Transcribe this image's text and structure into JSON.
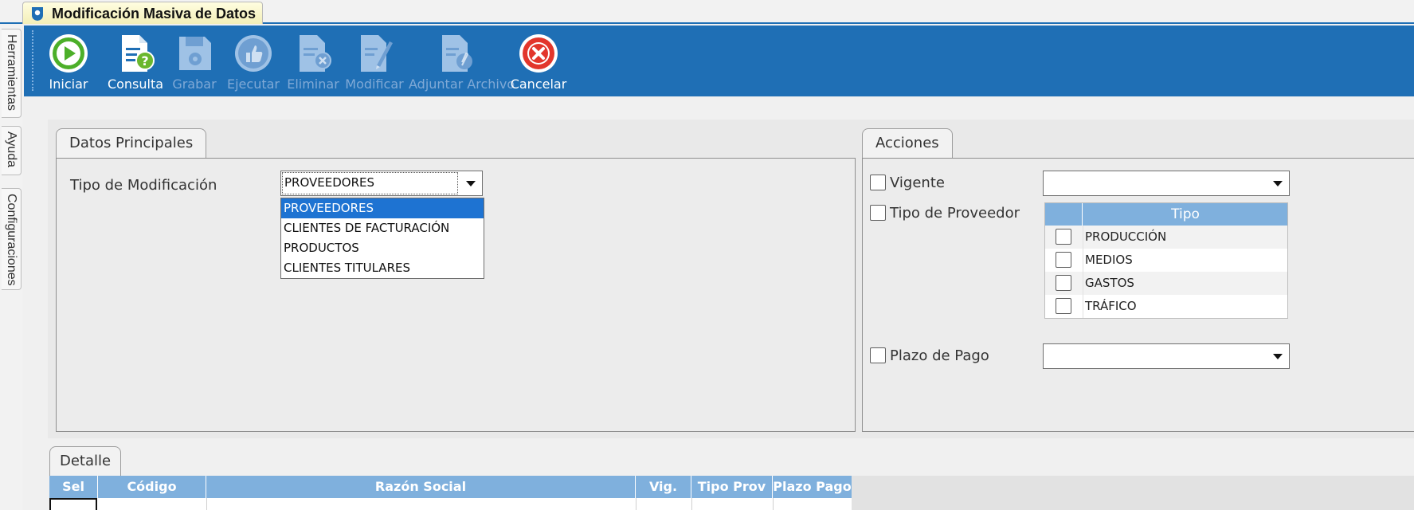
{
  "window": {
    "doc_tab_title": "Modificación Masiva de Datos",
    "side_tabs": [
      "Herramientas",
      "Ayuda",
      "Configuraciones"
    ]
  },
  "toolbar": {
    "buttons": [
      {
        "label": "Iniciar",
        "icon": "play-icon",
        "enabled": true
      },
      {
        "label": "Consulta",
        "icon": "query-document-icon",
        "enabled": true
      },
      {
        "label": "Grabar",
        "icon": "save-disk-icon",
        "enabled": false
      },
      {
        "label": "Ejecutar",
        "icon": "thumbs-up-icon",
        "enabled": false
      },
      {
        "label": "Eliminar",
        "icon": "delete-document-icon",
        "enabled": false
      },
      {
        "label": "Modificar",
        "icon": "edit-document-icon",
        "enabled": false
      },
      {
        "label": "Adjuntar Archivo",
        "icon": "attach-document-icon",
        "enabled": false
      },
      {
        "label": "Cancelar",
        "icon": "cancel-icon",
        "enabled": true
      }
    ]
  },
  "datos_principales": {
    "tab_label": "Datos Principales",
    "tipo_label": "Tipo de Modificación",
    "tipo_value": "PROVEEDORES",
    "options": [
      "PROVEEDORES",
      "CLIENTES DE FACTURACIÓN",
      "PRODUCTOS",
      "CLIENTES TITULARES"
    ],
    "selected_index": 0
  },
  "acciones": {
    "tab_label": "Acciones",
    "vigente_label": "Vigente",
    "vigente_value": "",
    "tipo_proveedor_label": "Tipo de Proveedor",
    "tipo_header": "Tipo",
    "tipos": [
      "PRODUCCIÓN",
      "MEDIOS",
      "GASTOS",
      "TRÁFICO"
    ],
    "plazo_label": "Plazo de Pago",
    "plazo_value": ""
  },
  "detalle": {
    "tab_label": "Detalle",
    "columns": [
      "Sel",
      "Código",
      "Razón Social",
      "Vig.",
      "Tipo Prov",
      "Plazo Pago"
    ]
  },
  "colors": {
    "toolbar_bg": "#1f6fb5",
    "grid_header_bg": "#7fb0dd",
    "dropdown_selected_bg": "#1e73d2"
  }
}
